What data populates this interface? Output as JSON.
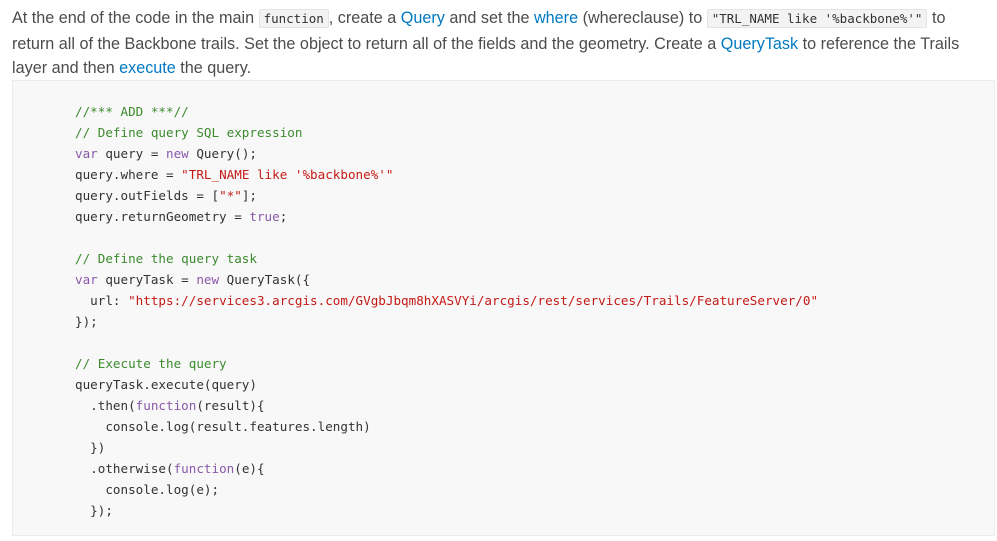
{
  "instruction": {
    "t1": "At the end of the code in the main ",
    "code_function": "function",
    "t2": ", create a ",
    "link_query": "Query",
    "t3": " and set the ",
    "link_where": "where",
    "t4": " (whereclause) to ",
    "code_where": "\"TRL_NAME like '%backbone%'\"",
    "t5": " to return all of the Backbone trails. Set the object to return all of the fields and the geometry. Create a ",
    "link_querytask": "QueryTask",
    "t6": " to reference the Trails layer and then ",
    "link_execute": "execute",
    "t7": " the query."
  },
  "code": {
    "l1": "//*** ADD ***//",
    "l2": "// Define query SQL expression",
    "l3_kw": "var",
    "l3_a": " query = ",
    "l3_kw2": "new",
    "l3_b": " Query();",
    "l4_a": "query.where = ",
    "l4_s": "\"TRL_NAME like '%backbone%'\"",
    "l5_a": "query.outFields = [",
    "l5_s": "\"*\"",
    "l5_b": "];",
    "l6_a": "query.returnGeometry = ",
    "l6_kw": "true",
    "l6_b": ";",
    "l8": "// Define the query task",
    "l9_kw": "var",
    "l9_a": " queryTask = ",
    "l9_kw2": "new",
    "l9_b": " QueryTask({",
    "l10_a": "  url: ",
    "l10_s": "\"https://services3.arcgis.com/GVgbJbqm8hXASVYi/arcgis/rest/services/Trails/FeatureServer/0\"",
    "l11": "});",
    "l13": "// Execute the query",
    "l14": "queryTask.execute(query)",
    "l15_a": "  .then(",
    "l15_kw": "function",
    "l15_b": "(result){",
    "l16": "    console.log(result.features.length)",
    "l17": "  })",
    "l18_a": "  .otherwise(",
    "l18_kw": "function",
    "l18_b": "(e){",
    "l19": "    console.log(e);",
    "l20": "  });"
  }
}
